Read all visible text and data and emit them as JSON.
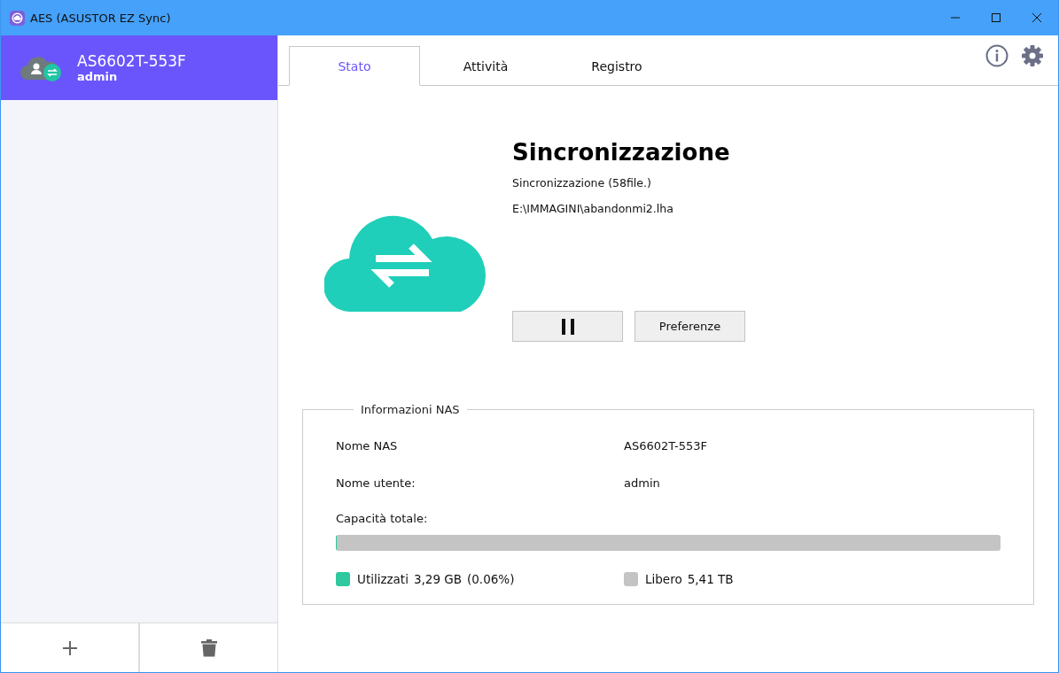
{
  "window": {
    "title": "AES (ASUSTOR EZ Sync)"
  },
  "sidebar": {
    "devices": [
      {
        "name": "AS6602T-553F",
        "user": "admin",
        "selected": true
      }
    ]
  },
  "tabs": [
    {
      "label": "Stato",
      "selected": true
    },
    {
      "label": "Attività",
      "selected": false
    },
    {
      "label": "Registro",
      "selected": false
    }
  ],
  "status": {
    "title": "Sincronizzazione",
    "detail": "Sincronizzazione (58file.)",
    "path": "E:\\IMMAGINI\\abandonmi2.lha"
  },
  "buttons": {
    "preferences": "Preferenze"
  },
  "nas_info": {
    "legend": "Informazioni NAS",
    "rows": [
      {
        "label": "Nome NAS",
        "value": "AS6602T-553F"
      },
      {
        "label": "Nome utente:",
        "value": "admin"
      }
    ],
    "capacity_label": "Capacità totale:",
    "capacity": {
      "level": 0.0006
    },
    "usage": [
      {
        "label": "Utilizzati",
        "amount": "3,29 GB",
        "percent": "(0.06%)",
        "color": "#2ec99e"
      },
      {
        "label": "Libero",
        "amount": "5,41 TB",
        "color": "#c4c4c4"
      }
    ]
  }
}
